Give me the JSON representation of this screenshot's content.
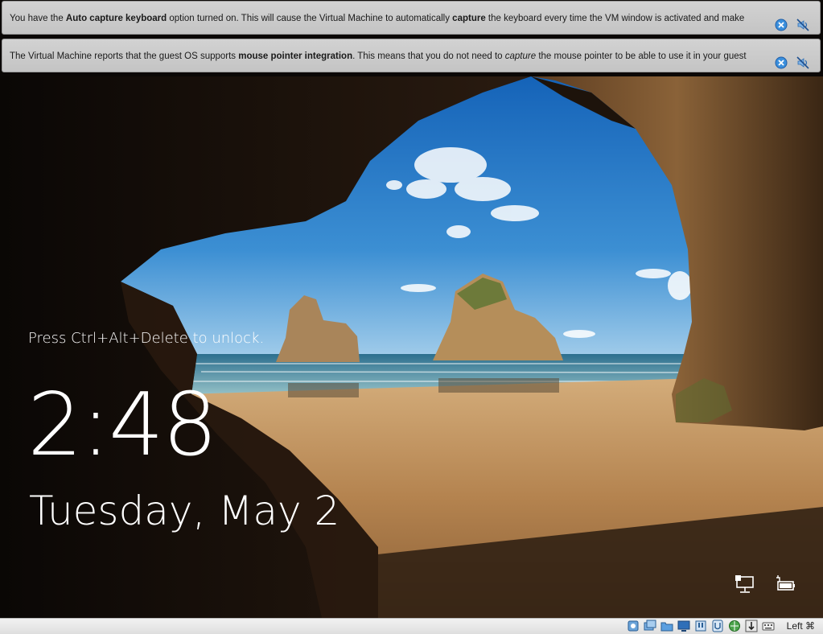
{
  "notifications": [
    {
      "segments": [
        {
          "text": "You have the ",
          "style": "normal"
        },
        {
          "text": "Auto capture keyboard",
          "style": "bold"
        },
        {
          "text": " option turned on. This will cause the Virtual Machine to automatically ",
          "style": "normal"
        },
        {
          "text": "capture",
          "style": "bold"
        },
        {
          "text": " the keyboard every time the VM window is activated and make",
          "style": "normal"
        }
      ]
    },
    {
      "segments": [
        {
          "text": "The Virtual Machine reports that the guest OS supports ",
          "style": "normal"
        },
        {
          "text": "mouse pointer integration",
          "style": "bold"
        },
        {
          "text": ". This means that you do not need to ",
          "style": "normal"
        },
        {
          "text": "capture",
          "style": "italic"
        },
        {
          "text": " the mouse pointer to be able to use it in your guest",
          "style": "normal"
        }
      ]
    }
  ],
  "lockscreen": {
    "unlock_hint": "Press Ctrl+Alt+Delete to unlock.",
    "time": "2:48",
    "date": "Tuesday, May 2"
  },
  "statusbar": {
    "icons": [
      "hard-disk-icon",
      "optical-drive-icon",
      "shared-folder-icon",
      "display-icon",
      "usb-icon",
      "video-capture-icon",
      "network-icon",
      "mouse-integration-icon",
      "keyboard-capture-icon"
    ],
    "host_key": "Left ⌘"
  },
  "colors": {
    "notice_bg": "#c9c9c9",
    "close_button": "#3b8fdc",
    "sky": "#2f7fc8",
    "sand": "#b48553"
  }
}
